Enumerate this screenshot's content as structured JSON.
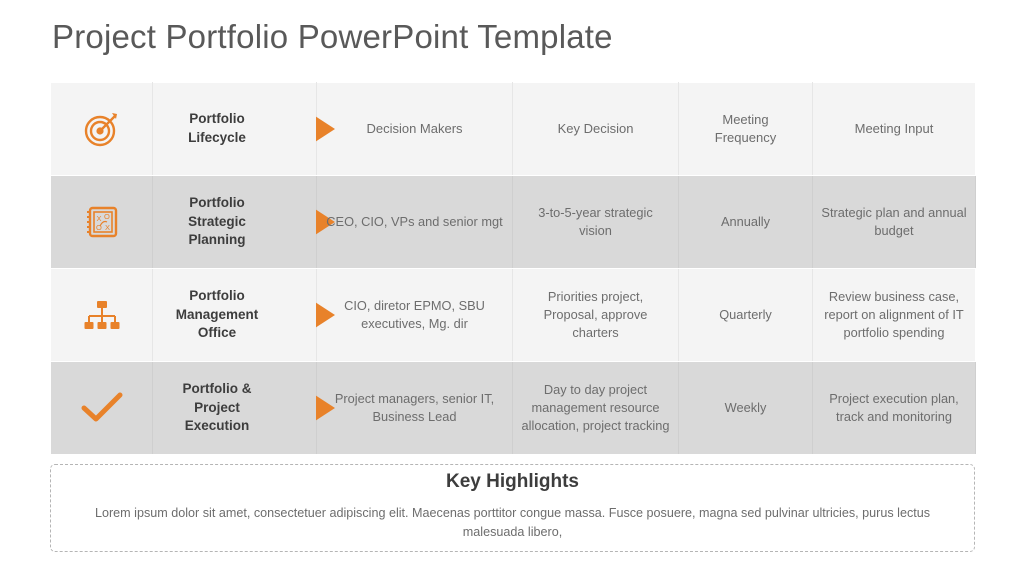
{
  "slide": {
    "title": "Project Portfolio PowerPoint Template",
    "accent_color": "#e8822a",
    "text_color": "#6d6d6d",
    "heading_color": "#3d3d3d",
    "row_light_bg": "#f4f4f4",
    "row_dark_bg": "#d9d9d9"
  },
  "table": {
    "columns": [
      {
        "key": "icon",
        "label": ""
      },
      {
        "key": "stage",
        "label": "Portfolio Lifecycle"
      },
      {
        "key": "makers",
        "label": "Decision Makers"
      },
      {
        "key": "decision",
        "label": "Key Decision"
      },
      {
        "key": "freq",
        "label": "Meeting Frequency"
      },
      {
        "key": "input",
        "label": "Meeting Input"
      }
    ],
    "header": {
      "icon": "target-bullseye-icon",
      "stage_line1": "Portfolio",
      "stage_line2": "Lifecycle",
      "arrow": "triangle-right-icon",
      "makers": "Decision Makers",
      "decision": "Key Decision",
      "freq_line1": "Meeting",
      "freq_line2": "Frequency",
      "input": "Meeting Input"
    },
    "rows": [
      {
        "icon": "strategy-playbook-icon",
        "stage_line1": "Portfolio",
        "stage_line2": "Strategic",
        "stage_line3": "Planning",
        "arrow": "triangle-right-icon",
        "makers": "CEO, CIO, VPs and senior mgt",
        "decision": "3-to-5-year strategic vision",
        "freq": "Annually",
        "input": "Strategic plan and annual budget",
        "shade": "dark"
      },
      {
        "icon": "org-chart-icon",
        "stage_line1": "Portfolio",
        "stage_line2": "Management",
        "stage_line3": "Office",
        "arrow": "triangle-right-icon",
        "makers": "CIO, diretor EPMO, SBU executives, Mg. dir",
        "decision": "Priorities project, Proposal, approve charters",
        "freq": "Quarterly",
        "input": "Review business case, report on alignment of IT portfolio spending",
        "shade": "light"
      },
      {
        "icon": "checkmark-icon",
        "stage_line1": "Portfolio &",
        "stage_line2": "Project",
        "stage_line3": "Execution",
        "arrow": "triangle-right-icon",
        "makers": "Project managers, senior IT, Business Lead",
        "decision": "Day to day project management resource allocation, project tracking",
        "freq": "Weekly",
        "input": "Project execution plan, track and monitoring",
        "shade": "dark"
      }
    ]
  },
  "highlights": {
    "title": "Key Highlights",
    "body": "Lorem ipsum dolor sit amet, consectetuer adipiscing elit. Maecenas porttitor congue massa. Fusce posuere, magna sed pulvinar ultricies, purus lectus malesuada libero,"
  }
}
